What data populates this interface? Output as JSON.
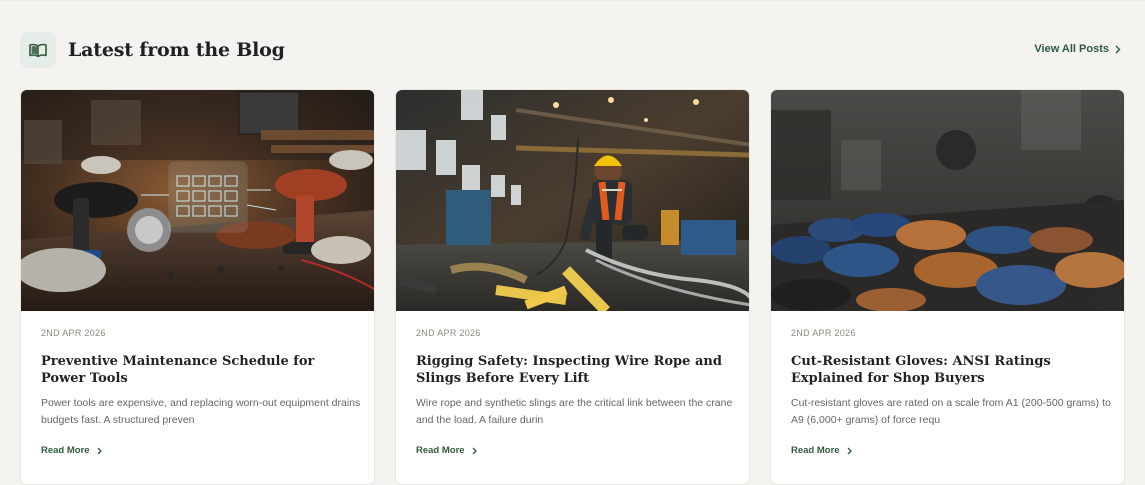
{
  "section": {
    "icon": "open-book-icon",
    "title": "Latest from the Blog",
    "view_all_label": "View All Posts",
    "accent": "#2f5a3d"
  },
  "posts": [
    {
      "date": "2ND APR 2026",
      "title": "Preventive Maintenance Schedule for Power Tools",
      "excerpt": "Power tools are expensive, and replacing worn-out equipment drains budgets fast. A structured preven",
      "read_more": "Read More",
      "image": "workshop-power-tools-with-holographic-checklist"
    },
    {
      "date": "2ND APR 2026",
      "title": "Rigging Safety: Inspecting Wire Rope and Slings Before Every Lift",
      "excerpt": "Wire rope and synthetic slings are the critical link between the crane and the load. A failure durin",
      "read_more": "Read More",
      "image": "worker-inspecting-wire-rope-in-warehouse"
    },
    {
      "date": "2ND APR 2026",
      "title": "Cut-Resistant Gloves: ANSI Ratings Explained for Shop Buyers",
      "excerpt": "Cut-resistant gloves are rated on a scale from A1 (200-500 grams) to A9 (6,000+ grams) of force requ",
      "read_more": "Read More",
      "image": "work-gloves-on-factory-table"
    }
  ]
}
